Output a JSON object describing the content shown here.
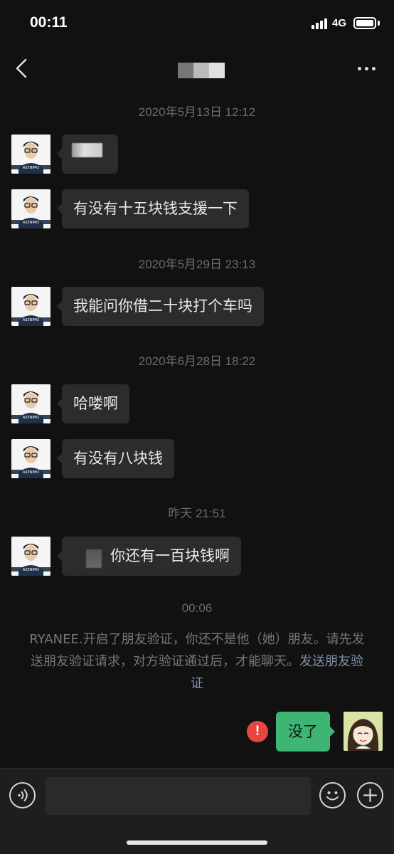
{
  "status": {
    "time": "00:11",
    "network": "4G"
  },
  "chat": {
    "messages": [
      {
        "timestamp": "2020年5月13日 12:12",
        "text": ""
      },
      {
        "text": "有没有十五块钱支援一下"
      },
      {
        "timestamp": "2020年5月29日 23:13",
        "text": "我能问你借二十块打个车吗"
      },
      {
        "timestamp": "2020年6月28日 18:22",
        "text": "哈喽啊"
      },
      {
        "text": "有没有八块钱"
      },
      {
        "timestamp": "昨天 21:51",
        "text": "你还有一百块钱啊"
      }
    ],
    "call_duration": "00:06",
    "system_notice": "RYANEE.开启了朋友验证，你还不是他（她）朋友。请先发送朋友验证请求，对方验证通过后，才能聊天。",
    "system_link": "发送朋友验证",
    "my_message": "没了",
    "error_mark": "!"
  },
  "avatar_caption": "ASENIMO",
  "colors": {
    "background": "#111111",
    "bubble": "#2c2c2c",
    "my_bubble": "#3eb575",
    "error": "#e5463f",
    "link": "#7d90a9"
  },
  "icons": [
    "back-icon",
    "more-icon",
    "voice-icon",
    "emoji-icon",
    "add-icon"
  ]
}
